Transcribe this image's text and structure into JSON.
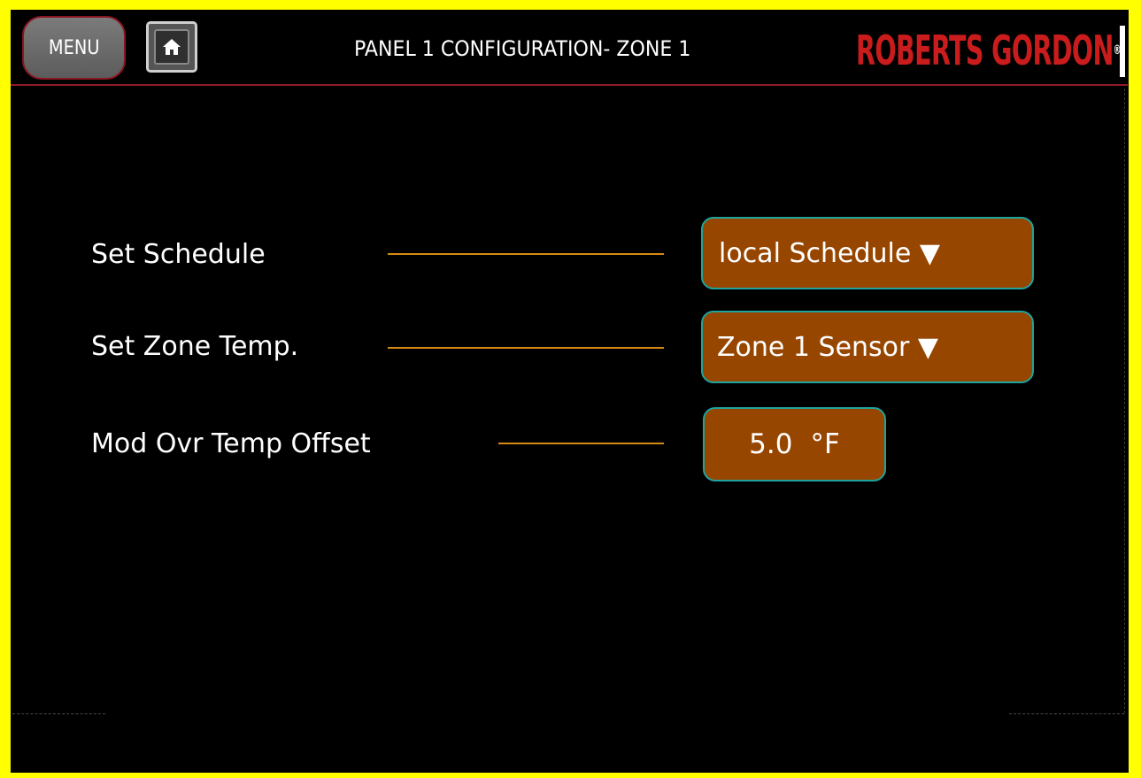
{
  "header": {
    "menu_label": "MENU",
    "title": "PANEL 1 CONFIGURATION- ZONE 1",
    "logo_text": "ROBERTS GORDON",
    "logo_mark": "®",
    "home_icon": "home-icon"
  },
  "rows": [
    {
      "label": "Set Schedule",
      "value": "local Schedule ▼"
    },
    {
      "label": "Set Zone Temp.",
      "value": "Zone 1 Sensor ▼"
    },
    {
      "label": "Mod Ovr Temp Offset",
      "value": "5.0",
      "unit": "°F"
    }
  ],
  "colors": {
    "frame": "#ffff00",
    "accent_line": "#d68a12",
    "control_fill": "#974600",
    "control_border": "#1fa39e",
    "brand_red": "#ca1c1c",
    "header_rule": "#8e1c24"
  }
}
